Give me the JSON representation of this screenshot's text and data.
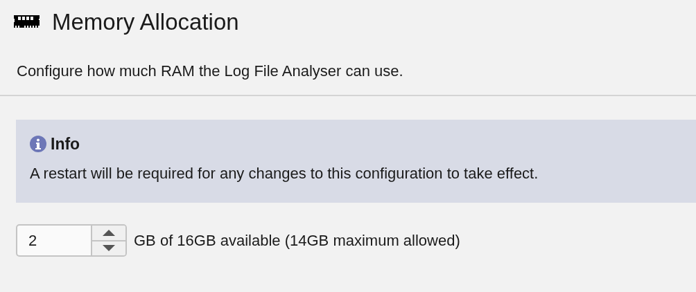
{
  "title": "Memory Allocation",
  "description": "Configure how much RAM the Log File Analyser can use.",
  "info": {
    "heading": "Info",
    "message": "A restart will be required for any changes to this configuration to take effect."
  },
  "memory": {
    "value": "2",
    "suffix": "GB of 16GB available (14GB maximum allowed)"
  }
}
